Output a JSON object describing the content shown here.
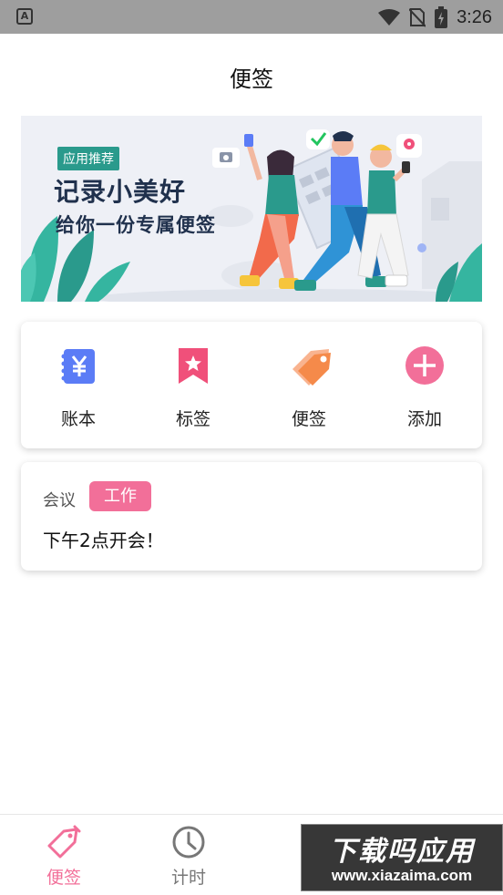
{
  "status_bar": {
    "time": "3:26"
  },
  "header": {
    "title": "便签"
  },
  "banner": {
    "tag": "应用推荐",
    "headline": "记录小美好",
    "subline": "给你一份专属便签"
  },
  "quick_actions": [
    {
      "label": "账本",
      "icon": "ledger-icon",
      "color": "#5b7cf6"
    },
    {
      "label": "标签",
      "icon": "bookmark-icon",
      "color": "#f0507a"
    },
    {
      "label": "便签",
      "icon": "tag-icon",
      "color": "#f58a4a"
    },
    {
      "label": "添加",
      "icon": "add-icon",
      "color": "#f26f99"
    }
  ],
  "notes": [
    {
      "category": "会议",
      "badge": "工作",
      "content": "下午2点开会！"
    }
  ],
  "tab_bar": {
    "active_color": "#f26f99",
    "inactive_color": "#777777",
    "tabs": [
      {
        "label": "便签",
        "icon": "note-tag-icon",
        "active": true
      },
      {
        "label": "计时",
        "icon": "clock-icon",
        "active": false
      }
    ]
  },
  "watermark": {
    "line1": "下载吗应用",
    "line2": "www.xiazaima.com"
  }
}
